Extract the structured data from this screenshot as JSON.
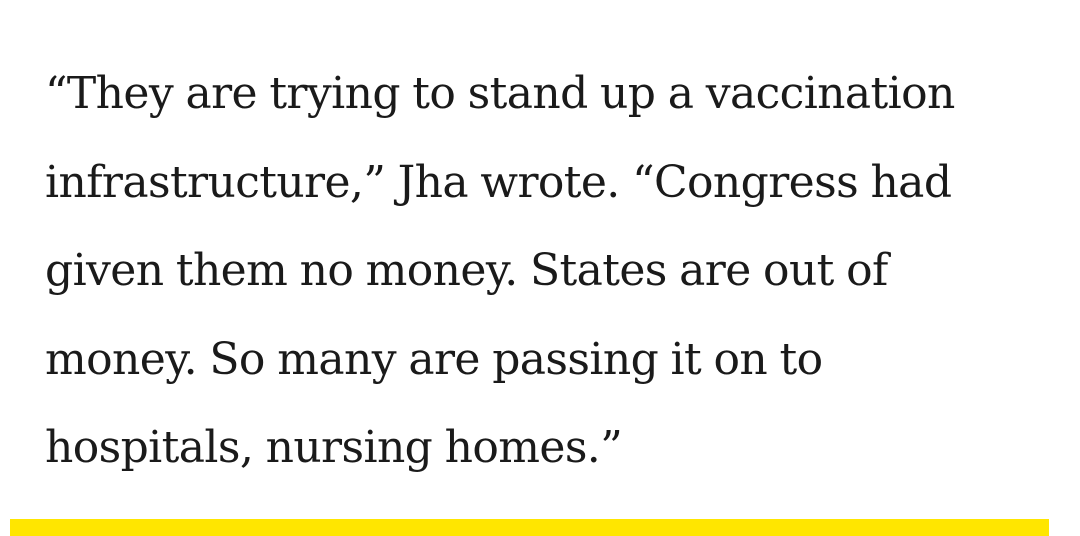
{
  "article": {
    "paragraph_lines": [
      "“They are trying to stand up a vaccination",
      "infrastructure,” Jha wrote. “Congress had",
      "given them no money. States are out of",
      "money. So many are passing it on to",
      "hospitals, nursing homes.”"
    ]
  },
  "colors": {
    "text": "#1a1a1a",
    "background": "#ffffff",
    "accent_bar": "#ffe600"
  }
}
